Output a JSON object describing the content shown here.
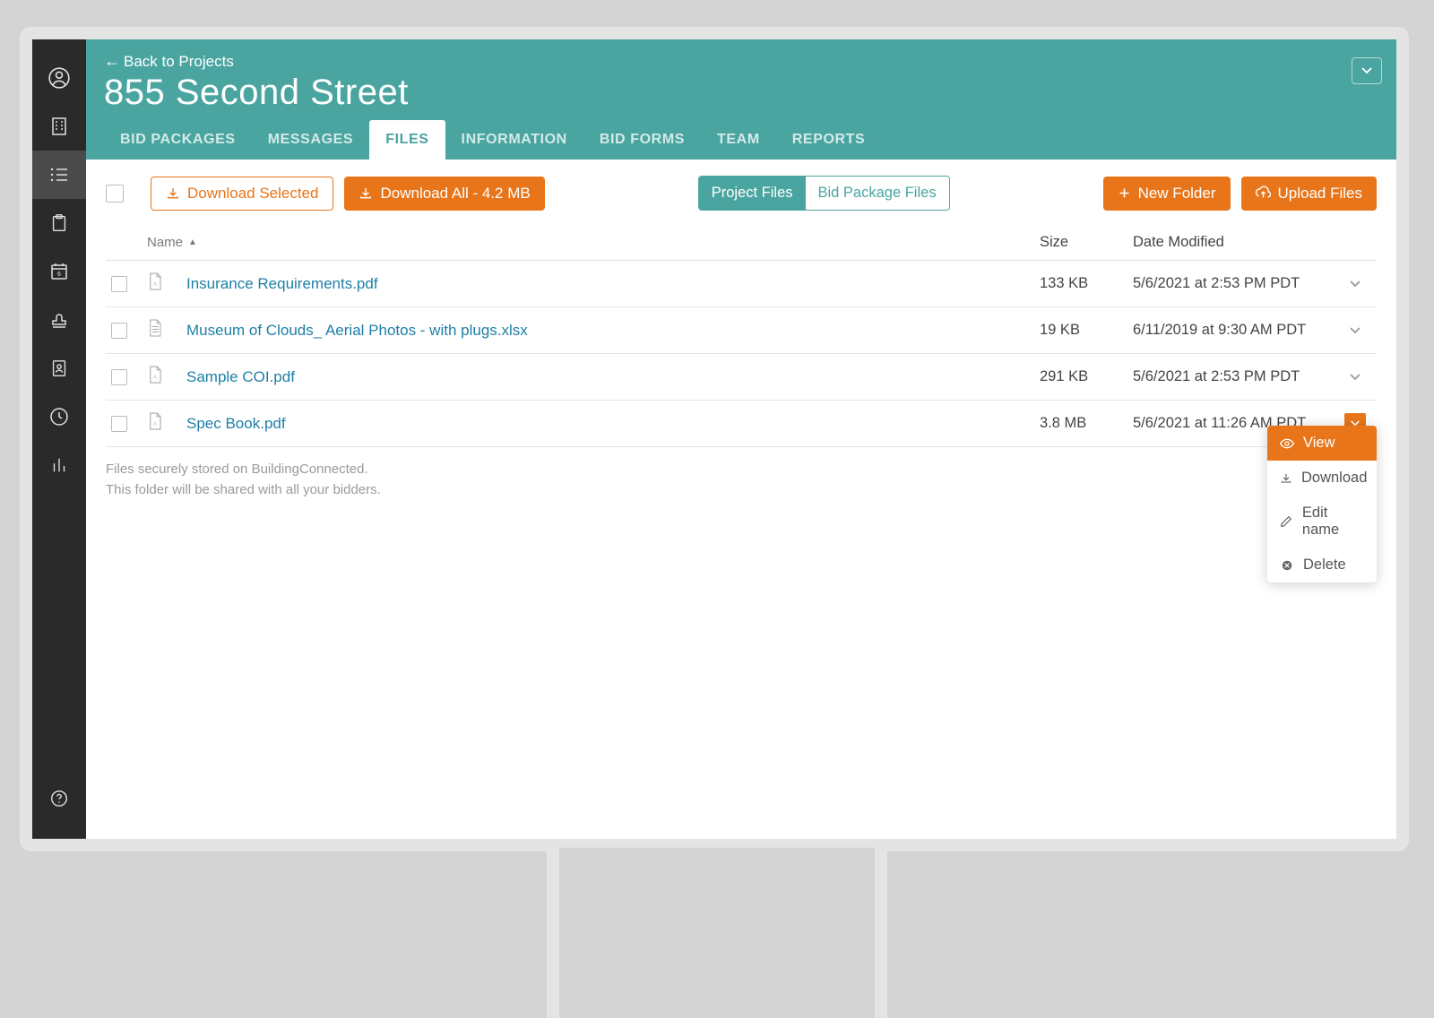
{
  "header": {
    "back": "Back to Projects",
    "title": "855 Second Street",
    "tabs": [
      "BID PACKAGES",
      "MESSAGES",
      "FILES",
      "INFORMATION",
      "BID FORMS",
      "TEAM",
      "REPORTS"
    ],
    "active_tab": 2
  },
  "toolbar": {
    "download_selected": "Download Selected",
    "download_all": "Download All - 4.2 MB",
    "project_files": "Project Files",
    "bid_package_files": "Bid Package Files",
    "new_folder": "New Folder",
    "upload_files": "Upload Files"
  },
  "columns": {
    "name": "Name",
    "size": "Size",
    "date": "Date Modified"
  },
  "files": [
    {
      "name": "Insurance Requirements.pdf",
      "type": "pdf",
      "size": "133 KB",
      "date": "5/6/2021 at 2:53 PM PDT"
    },
    {
      "name": "Museum of Clouds_ Aerial Photos - with plugs.xlsx",
      "type": "xlsx",
      "size": "19 KB",
      "date": "6/11/2019 at 9:30 AM PDT"
    },
    {
      "name": "Sample COI.pdf",
      "type": "pdf",
      "size": "291 KB",
      "date": "5/6/2021 at 2:53 PM PDT"
    },
    {
      "name": "Spec Book.pdf",
      "type": "pdf",
      "size": "3.8 MB",
      "date": "5/6/2021 at 11:26 AM PDT"
    }
  ],
  "row_menu": {
    "view": "View",
    "download": "Download",
    "edit": "Edit name",
    "delete": "Delete"
  },
  "footer": {
    "line1": "Files securely stored on BuildingConnected.",
    "line2": "This folder will be shared with all your bidders."
  }
}
